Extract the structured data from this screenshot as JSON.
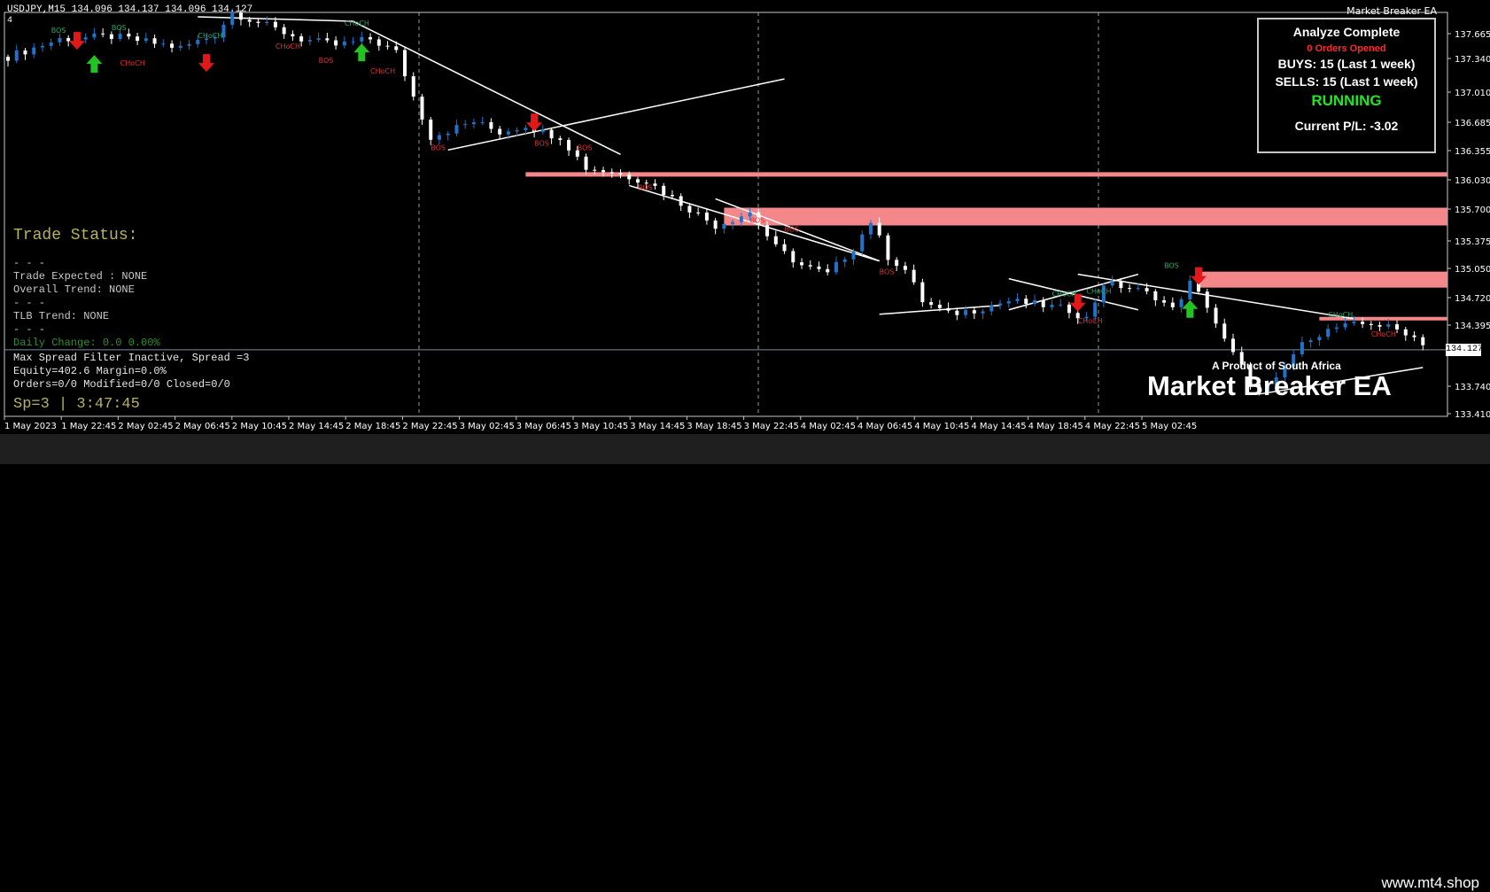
{
  "chart_data": {
    "type": "candlestick",
    "title": "USDJPY,M15  134.096 134.137 134.096 134.127",
    "ylim": [
      133.3,
      137.85
    ],
    "y_ticks": [
      "137.665",
      "137.340",
      "137.010",
      "136.685",
      "136.355",
      "136.030",
      "135.700",
      "135.375",
      "135.050",
      "134.720",
      "134.395",
      "134.127",
      "133.740",
      "133.410"
    ],
    "x_ticks": [
      "1 May 2023",
      "1 May 22:45",
      "2 May 02:45",
      "2 May 06:45",
      "2 May 10:45",
      "2 May 14:45",
      "2 May 18:45",
      "2 May 22:45",
      "3 May 02:45",
      "3 May 06:45",
      "3 May 10:45",
      "3 May 14:45",
      "3 May 18:45",
      "3 May 22:45",
      "4 May 02:45",
      "4 May 06:45",
      "4 May 10:45",
      "4 May 14:45",
      "4 May 18:45",
      "4 May 22:45",
      "5 May 02:45"
    ],
    "price_path": [
      [
        0,
        137.35
      ],
      [
        6,
        137.55
      ],
      [
        12,
        137.58
      ],
      [
        16,
        137.52
      ],
      [
        20,
        137.45
      ],
      [
        24,
        137.6
      ],
      [
        26,
        137.85
      ],
      [
        30,
        137.7
      ],
      [
        34,
        137.55
      ],
      [
        38,
        137.48
      ],
      [
        42,
        137.55
      ],
      [
        45,
        137.4
      ],
      [
        47,
        136.9
      ],
      [
        49,
        136.45
      ],
      [
        51,
        136.52
      ],
      [
        54,
        136.62
      ],
      [
        57,
        136.5
      ],
      [
        60,
        136.58
      ],
      [
        62,
        136.5
      ],
      [
        64,
        136.45
      ],
      [
        67,
        136.1
      ],
      [
        70,
        136.05
      ],
      [
        74,
        135.95
      ],
      [
        78,
        135.7
      ],
      [
        82,
        135.45
      ],
      [
        86,
        135.6
      ],
      [
        89,
        135.2
      ],
      [
        92,
        135.0
      ],
      [
        95,
        134.9
      ],
      [
        98,
        135.2
      ],
      [
        100,
        135.5
      ],
      [
        102,
        135.1
      ],
      [
        104,
        134.95
      ],
      [
        106,
        134.6
      ],
      [
        109,
        134.45
      ],
      [
        112,
        134.5
      ],
      [
        116,
        134.6
      ],
      [
        120,
        134.55
      ],
      [
        123,
        134.5
      ],
      [
        125,
        134.4
      ],
      [
        127,
        134.8
      ],
      [
        130,
        134.75
      ],
      [
        133,
        134.65
      ],
      [
        135,
        134.5
      ],
      [
        137,
        134.8
      ],
      [
        139,
        134.55
      ],
      [
        141,
        134.15
      ],
      [
        143,
        133.85
      ],
      [
        145,
        133.55
      ],
      [
        147,
        133.7
      ],
      [
        149,
        134.0
      ],
      [
        151,
        134.2
      ],
      [
        154,
        134.3
      ],
      [
        158,
        134.35
      ],
      [
        162,
        134.25
      ],
      [
        164,
        134.13
      ]
    ],
    "supply_zones": [
      [
        136.0,
        136.05
      ],
      [
        135.45,
        135.65
      ],
      [
        134.75,
        134.93
      ],
      [
        134.38,
        134.42
      ]
    ],
    "markers": {
      "buy": [
        [
          10,
          137.25
        ],
        [
          41,
          137.38
        ],
        [
          137,
          134.49
        ]
      ],
      "sell": [
        [
          8,
          137.55
        ],
        [
          23,
          137.3
        ],
        [
          61,
          136.63
        ],
        [
          124,
          134.6
        ],
        [
          138,
          134.9
        ]
      ]
    },
    "labels": [
      [
        "BOS",
        5,
        137.62,
        "buy"
      ],
      [
        "BOS",
        12,
        137.65,
        "buy"
      ],
      [
        "CHoCH",
        13,
        137.25,
        "sell"
      ],
      [
        "CHoCH",
        22,
        137.56,
        "buy"
      ],
      [
        "CHoCH",
        31,
        137.44,
        "sell"
      ],
      [
        "BOS",
        36,
        137.28,
        "sell"
      ],
      [
        "CHoCH",
        39,
        137.7,
        "buy"
      ],
      [
        "CHoCH",
        42,
        137.16,
        "sell"
      ],
      [
        "BOS",
        49,
        136.3,
        "sell"
      ],
      [
        "BOS",
        61,
        136.35,
        "sell"
      ],
      [
        "BOS",
        66,
        136.3,
        "sell"
      ],
      [
        "BOS",
        73,
        135.85,
        "sell"
      ],
      [
        "BOS",
        86,
        135.48,
        "sell"
      ],
      [
        "BOS",
        90,
        135.38,
        "sell"
      ],
      [
        "BOS",
        101,
        134.9,
        "sell"
      ],
      [
        "CHoCH",
        121,
        134.65,
        "buy"
      ],
      [
        "CHoCH",
        125,
        134.68,
        "buy"
      ],
      [
        "CHoCH",
        124,
        134.35,
        "sell"
      ],
      [
        "BOS",
        134,
        134.97,
        "buy"
      ],
      [
        "CHoCH",
        153,
        134.42,
        "buy"
      ],
      [
        "CHoCH",
        158,
        134.2,
        "sell"
      ]
    ]
  },
  "header": {
    "symbol_line": "USDJPY,M15  134.096 134.137 134.096 134.127",
    "subwindow": "4",
    "ea_name": "Market Breaker EA"
  },
  "status_panel": {
    "title": "Analyze Complete",
    "orders": "0 Orders Opened",
    "buys": "BUYS: 15 (Last 1 week)",
    "sells": "SELLS: 15 (Last 1 week)",
    "state": "RUNNING",
    "pl": "Current P/L: -3.02"
  },
  "trade_info": {
    "heading": "Trade Status:",
    "sep1": "- - -",
    "expected": "Trade Expected : NONE",
    "trend": "Overall Trend: NONE",
    "sep2": "- - -",
    "tlb": "TLB Trend: NONE",
    "sep3": "- - -",
    "daily": "Daily Change: 0.0 0.00%",
    "spread": "Max Spread Filter Inactive, Spread =3",
    "equity": "Equity=402.6 Margin=0.0%",
    "orders": "Orders=0/0 Modified=0/0 Closed=0/0",
    "sp": "Sp=3 | 3:47:45"
  },
  "branding": {
    "sub": "A Product of South Africa",
    "main": "Market Breaker EA",
    "site": "www.mt4.shop"
  },
  "colors": {
    "bull": "#1f73c9",
    "bear": "#ffffff",
    "zone": "#f4878a",
    "buy_arrow": "#22c322",
    "sell_arrow": "#e11818",
    "buy_label": "#2aa86a",
    "sell_label": "#e03030",
    "trendline": "#ffffff",
    "grid": "#9a9a9a"
  }
}
